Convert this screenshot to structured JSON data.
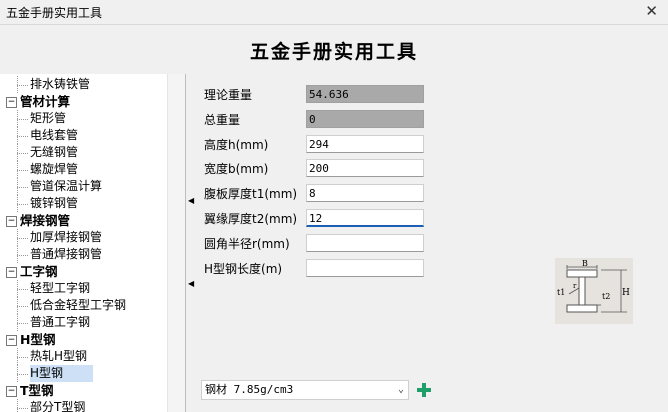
{
  "window": {
    "title": "五金手册实用工具",
    "close_glyph": "✕"
  },
  "header": {
    "title": "五金手册实用工具"
  },
  "tree": {
    "nodes": [
      {
        "label": "排水铸铁管",
        "kind": "leaf"
      },
      {
        "label": "管材计算",
        "kind": "category"
      },
      {
        "label": "矩形管",
        "kind": "leaf"
      },
      {
        "label": "电线套管",
        "kind": "leaf"
      },
      {
        "label": "无缝钢管",
        "kind": "leaf"
      },
      {
        "label": "螺旋焊管",
        "kind": "leaf"
      },
      {
        "label": "管道保温计算",
        "kind": "leaf"
      },
      {
        "label": "镀锌钢管",
        "kind": "leaf"
      },
      {
        "label": "焊接钢管",
        "kind": "category"
      },
      {
        "label": "加厚焊接钢管",
        "kind": "leaf"
      },
      {
        "label": "普通焊接钢管",
        "kind": "leaf"
      },
      {
        "label": "工字钢",
        "kind": "category"
      },
      {
        "label": "轻型工字钢",
        "kind": "leaf"
      },
      {
        "label": "低合金轻型工字钢",
        "kind": "leaf"
      },
      {
        "label": "普通工字钢",
        "kind": "leaf"
      },
      {
        "label": "H型钢",
        "kind": "category"
      },
      {
        "label": "热轧H型钢",
        "kind": "leaf"
      },
      {
        "label": "H型钢",
        "kind": "leaf",
        "selected": true
      },
      {
        "label": "T型钢",
        "kind": "category"
      },
      {
        "label": "部分T型钢",
        "kind": "leaf"
      }
    ],
    "collapse_glyph": "−"
  },
  "form": {
    "fields": [
      {
        "label": "理论重量",
        "value": "54.636",
        "readonly": true
      },
      {
        "label": "总重量",
        "value": "0",
        "readonly": true
      },
      {
        "label": "高度h(mm)",
        "value": "294",
        "readonly": false
      },
      {
        "label": "宽度b(mm)",
        "value": "200",
        "readonly": false
      },
      {
        "label": "腹板厚度t1(mm)",
        "value": "8",
        "readonly": false
      },
      {
        "label": "翼缘厚度t2(mm)",
        "value": "12",
        "readonly": false,
        "focused": true
      },
      {
        "label": "圆角半径r(mm)",
        "value": "",
        "readonly": false
      },
      {
        "label": "H型钢长度(m)",
        "value": "",
        "readonly": false
      }
    ],
    "material": {
      "selected": "钢材 7.85g/cm3"
    }
  },
  "diagram": {
    "labels": {
      "b": "B",
      "h": "H",
      "t1": "t1",
      "t2": "t2",
      "r": "r"
    }
  },
  "colors": {
    "accent_add": "#1e9e6a",
    "selection": "#cde0f5",
    "readonly_bg": "#a9a9a9",
    "focus_underline": "#1a5fb4"
  }
}
